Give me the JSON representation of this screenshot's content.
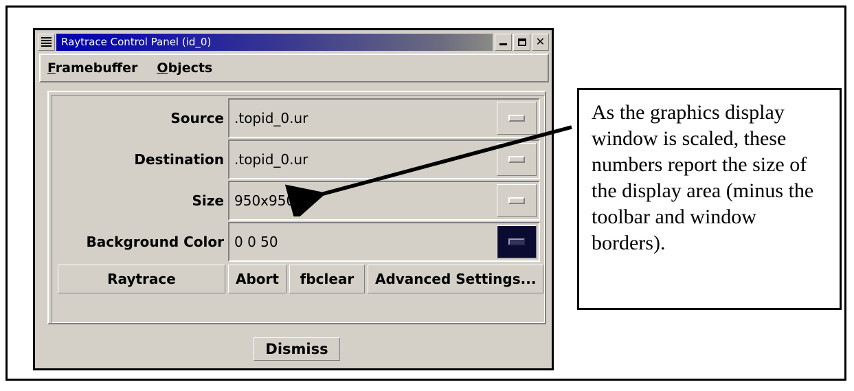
{
  "window": {
    "title": "Raytrace Control Panel (id_0)",
    "menu_icon": "window-menu-icon",
    "controls": [
      {
        "name": "minimize",
        "glyph": "_"
      },
      {
        "name": "maximize",
        "glyph": "□"
      },
      {
        "name": "close",
        "glyph": "×"
      }
    ]
  },
  "menubar": {
    "items": [
      {
        "label": "Framebuffer",
        "mnemonic": "F",
        "rest": "ramebuffer"
      },
      {
        "label": "Objects",
        "mnemonic": "O",
        "rest": "bjects"
      }
    ]
  },
  "form": {
    "rows": [
      {
        "label": "Source",
        "value": ".topid_0.ur",
        "option_icon": "dash-icon",
        "swatch": false
      },
      {
        "label": "Destination",
        "value": ".topid_0.ur",
        "option_icon": "dash-icon",
        "swatch": false
      },
      {
        "label": "Size",
        "value": "950x950",
        "option_icon": "dash-icon",
        "swatch": false
      },
      {
        "label": "Background Color",
        "value": "0 0 50",
        "option_icon": "dash-icon",
        "swatch": true
      }
    ]
  },
  "buttons": {
    "raytrace": "Raytrace",
    "abort": "Abort",
    "fbclear": "fbclear",
    "advanced": "Advanced Settings...",
    "dismiss": "Dismiss"
  },
  "callout": {
    "text": "As the graphics display window is scaled, these numbers report the size of the display area (minus the toolbar and window borders)."
  },
  "colors": {
    "panel": "#d4d0c8",
    "titlebar_start": "#0000b0",
    "titlebar_end": "#8a8a86",
    "swatch": "#0b0b32",
    "frame": "#000000"
  }
}
